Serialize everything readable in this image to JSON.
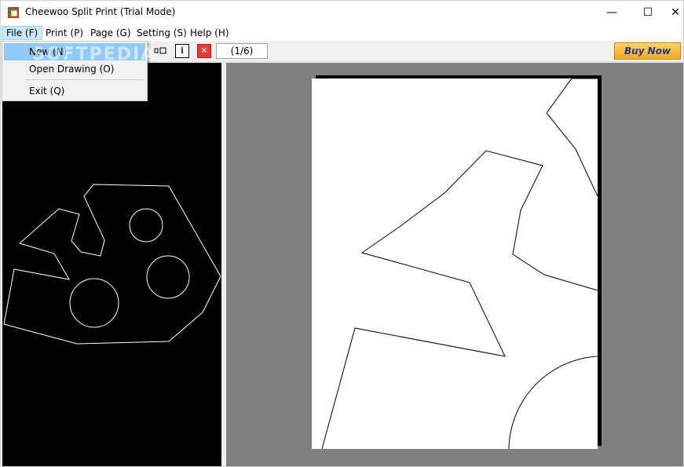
{
  "window": {
    "title": "Cheewoo Split Print (Trial Mode)",
    "minimize_glyph": "—",
    "maximize_glyph": "☐",
    "close_glyph": "✕"
  },
  "menubar": {
    "items": [
      {
        "label": "File (F)"
      },
      {
        "label": "Print (P)"
      },
      {
        "label": "Page (G)"
      },
      {
        "label": "Setting (S)"
      },
      {
        "label": "Help (H)"
      }
    ]
  },
  "file_menu": {
    "items": [
      {
        "label": "New (N)"
      },
      {
        "label": "Open Drawing (O)"
      },
      {
        "label": "Exit (Q)"
      }
    ]
  },
  "toolbar": {
    "page_counter": "(1/6)",
    "buy_label": "Buy Now",
    "info_glyph": "i",
    "close_glyph": "✕",
    "icons": [
      "split-view-icon",
      "info-icon",
      "close-red-icon"
    ]
  },
  "watermark": "SOFTPEDIA",
  "colors": {
    "accent_buy": "#f5a623",
    "menu_highlight": "#91c9f7",
    "left_canvas_bg": "#000000",
    "right_canvas_bg": "#808080",
    "page_bg": "#ffffff"
  }
}
